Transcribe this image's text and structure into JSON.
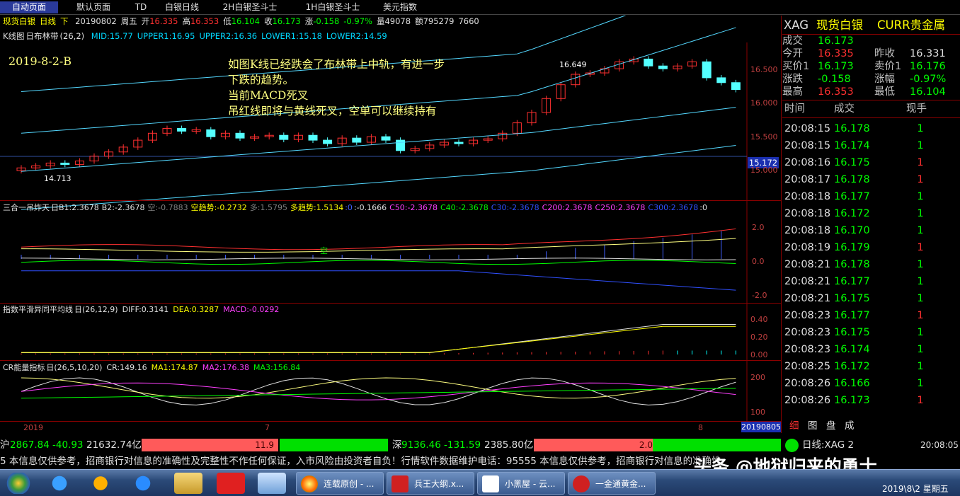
{
  "tabs": [
    "自动页面",
    "默认页面",
    "TD",
    "白银日线",
    "2H白银圣斗士",
    "1H白银圣斗士",
    "美元指数"
  ],
  "header": {
    "name": "现货白银",
    "period": "日线",
    "dir": "下",
    "date": "20190802",
    "weekday": "周五",
    "open_label": "开",
    "open": "16.335",
    "high_label": "高",
    "high": "16.353",
    "low_label": "低",
    "low": "16.104",
    "close_label": "收",
    "close": "16.173",
    "chg_label": "涨",
    "chg": "-0.158",
    "pct": "-0.97%",
    "vol_label": "量",
    "vol": "49078",
    "amt_label": "额",
    "amt": "795279",
    "extra": "7660"
  },
  "kline_panel": {
    "title": "K线图",
    "indicator": "日布林带",
    "params": "(26,2)",
    "mid": "MID:15.77",
    "upper1": "UPPER1:16.95",
    "upper2": "UPPER2:16.36",
    "lower1": "LOWER1:15.18",
    "lower2": "LOWER2:14.59",
    "chart_label": "2019-8-2-B",
    "annotation": [
      "如图K线已经跌会了布林带上中轨，有进一步",
      "下跌的趋势。",
      "当前MACD死叉",
      "吊红线即将与黄线死叉，空单可以继续持有"
    ],
    "high_marker": "16.649",
    "low_marker": "14.713",
    "price_tag": "15.172",
    "yticks": [
      "16.500",
      "16.000",
      "15.500",
      "15.000"
    ]
  },
  "ind1_panel": {
    "title": "三合一吊炸天",
    "params": "日B1:2.3678",
    "b2": "B2:-2.3678",
    "kong": "空:-0.7883",
    "kong_trend": "空趋势:-0.2732",
    "duo": "多:1.5795",
    "duo_trend": "多趋势:1.5134",
    "zero": ":0",
    "neg": ":-0.1666",
    "c50": "C50:-2.3678",
    "c40": "C40:-2.3678",
    "c30": "C30:-2.3678",
    "c200": "C200:2.3678",
    "c250": "C250:2.3678",
    "c300": "C300:2.3678",
    "zero2": ":0",
    "yticks": [
      "2.0",
      "0.0",
      "-2.0"
    ],
    "mark": "空"
  },
  "macd_panel": {
    "title": "指数平滑异同平均线",
    "params": "日(26,12,9)",
    "diff": "DIFF:0.3141",
    "dea": "DEA:0.3287",
    "macd": "MACD:-0.0292",
    "yticks": [
      "0.40",
      "0.20",
      "0.00"
    ]
  },
  "cr_panel": {
    "title": "CR能量指标",
    "params": "日(26,5,10,20)",
    "cr": "CR:149.16",
    "ma1": "MA1:174.87",
    "ma2": "MA2:176.38",
    "ma3": "MA3:156.84",
    "yticks": [
      "200",
      "100"
    ]
  },
  "xaxis": {
    "labels": [
      "2019",
      "7",
      "8"
    ],
    "date_tag": "20190805"
  },
  "quote": {
    "code": "XAG",
    "name": "现货白银",
    "category": "CURR贵金属",
    "deal_label": "成交",
    "deal": "16.173",
    "open_label": "今开",
    "open": "16.335",
    "prev_label": "昨收",
    "prev": "16.331",
    "buy_label": "买价1",
    "buy": "16.173",
    "sell_label": "卖价1",
    "sell": "16.176",
    "chg_label": "涨跌",
    "chg": "-0.158",
    "pct_label": "涨幅",
    "pct": "-0.97%",
    "high_label": "最高",
    "high": "16.353",
    "low_label": "最低",
    "low": "16.104"
  },
  "ticks_header": [
    "时间",
    "成交",
    "现手"
  ],
  "ticks": [
    {
      "time": "20:08:15",
      "price": "16.178",
      "qty": "1",
      "c": "g"
    },
    {
      "time": "20:08:15",
      "price": "16.174",
      "qty": "1",
      "c": "g"
    },
    {
      "time": "20:08:16",
      "price": "16.175",
      "qty": "1",
      "c": "r"
    },
    {
      "time": "20:08:17",
      "price": "16.178",
      "qty": "1",
      "c": "r"
    },
    {
      "time": "20:08:18",
      "price": "16.177",
      "qty": "1",
      "c": "g"
    },
    {
      "time": "20:08:18",
      "price": "16.172",
      "qty": "1",
      "c": "g"
    },
    {
      "time": "20:08:18",
      "price": "16.170",
      "qty": "1",
      "c": "g"
    },
    {
      "time": "20:08:19",
      "price": "16.179",
      "qty": "1",
      "c": "r"
    },
    {
      "time": "20:08:21",
      "price": "16.178",
      "qty": "1",
      "c": "g"
    },
    {
      "time": "20:08:21",
      "price": "16.177",
      "qty": "1",
      "c": "g"
    },
    {
      "time": "20:08:21",
      "price": "16.175",
      "qty": "1",
      "c": "g"
    },
    {
      "time": "20:08:23",
      "price": "16.177",
      "qty": "1",
      "c": "r"
    },
    {
      "time": "20:08:23",
      "price": "16.175",
      "qty": "1",
      "c": "g"
    },
    {
      "time": "20:08:23",
      "price": "16.174",
      "qty": "1",
      "c": "g"
    },
    {
      "time": "20:08:25",
      "price": "16.172",
      "qty": "1",
      "c": "g"
    },
    {
      "time": "20:08:26",
      "price": "16.166",
      "qty": "1",
      "c": "g"
    },
    {
      "time": "20:08:26",
      "price": "16.173",
      "qty": "1",
      "c": "r"
    }
  ],
  "right_tabs": [
    "细",
    "图",
    "盘",
    "成"
  ],
  "status": {
    "sh_label": "沪",
    "sh": "2867.84",
    "sh_chg": "-40.93",
    "sh_amt": "21632.74亿",
    "bar1": "11.9",
    "sz_label": "深",
    "sz": "9136.46",
    "sz_chg": "-131.59",
    "sz_amt": "2385.80亿",
    "bar2": "2.0",
    "right_label": "日线:XAG 2",
    "time": "20:08:05"
  },
  "ticker": "5    本信息仅供参考，招商银行对信息的准确性及完整性不作任何保证，入市风险由投资者自负！行情软件数据维护电话：95555    本信息仅供参考，招商银行对信息的准确性",
  "watermark": "头条 @地狱归来的勇士",
  "taskbar": {
    "items": [
      "连载原创 - ...",
      "兵王大纲.x...",
      "小黑屋 - 云...",
      "一金通黄金..."
    ],
    "clock": "2019\\8\\2 星期五"
  }
}
